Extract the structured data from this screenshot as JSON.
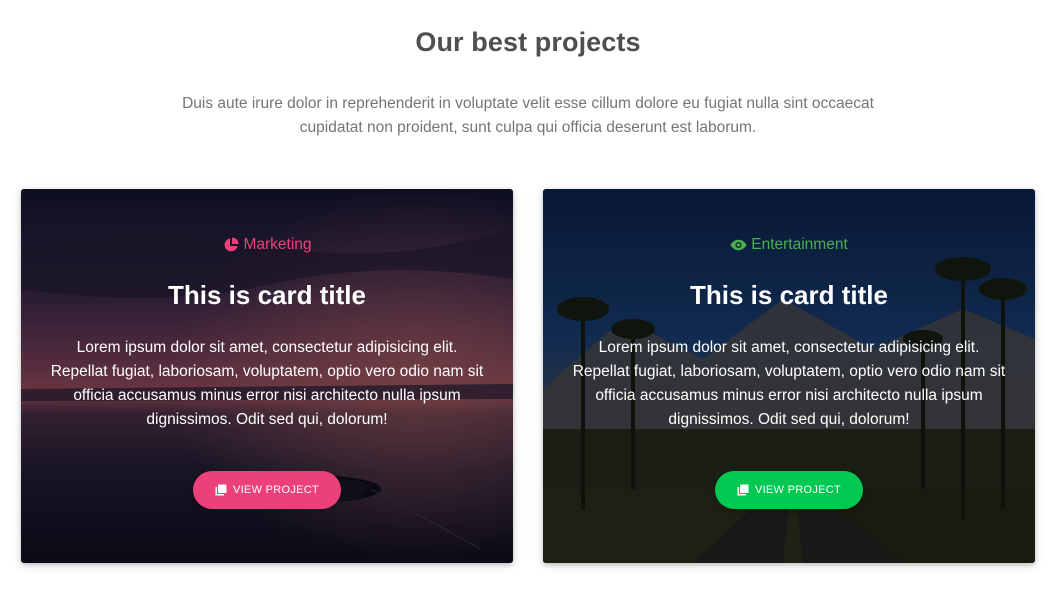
{
  "section": {
    "title": "Our best projects",
    "description": "Duis aute irure dolor in reprehenderit in voluptate velit esse cillum dolore eu fugiat nulla sint occaecat cupidatat non proident, sunt culpa qui officia deserunt est laborum."
  },
  "cards": [
    {
      "category": "Marketing",
      "category_icon": "pie-chart-icon",
      "category_color": "#ec407a",
      "title": "This is card title",
      "text": "Lorem ipsum dolor sit amet, consectetur adipisicing elit. Repellat fugiat, laboriosam, voluptatem, optio vero odio nam sit officia accusamus minus error nisi architecto nulla ipsum dignissimos. Odit sed qui, dolorum!",
      "button_label": "VIEW PROJECT",
      "button_icon": "clone-icon",
      "button_color": "#ec407a"
    },
    {
      "category": "Entertainment",
      "category_icon": "eye-icon",
      "category_color": "#4caf50",
      "title": "This is card title",
      "text": "Lorem ipsum dolor sit amet, consectetur adipisicing elit. Repellat fugiat, laboriosam, voluptatem, optio vero odio nam sit officia accusamus minus error nisi architecto nulla ipsum dignissimos. Odit sed qui, dolorum!",
      "button_label": "VIEW PROJECT",
      "button_icon": "clone-icon",
      "button_color": "#00c851"
    }
  ]
}
